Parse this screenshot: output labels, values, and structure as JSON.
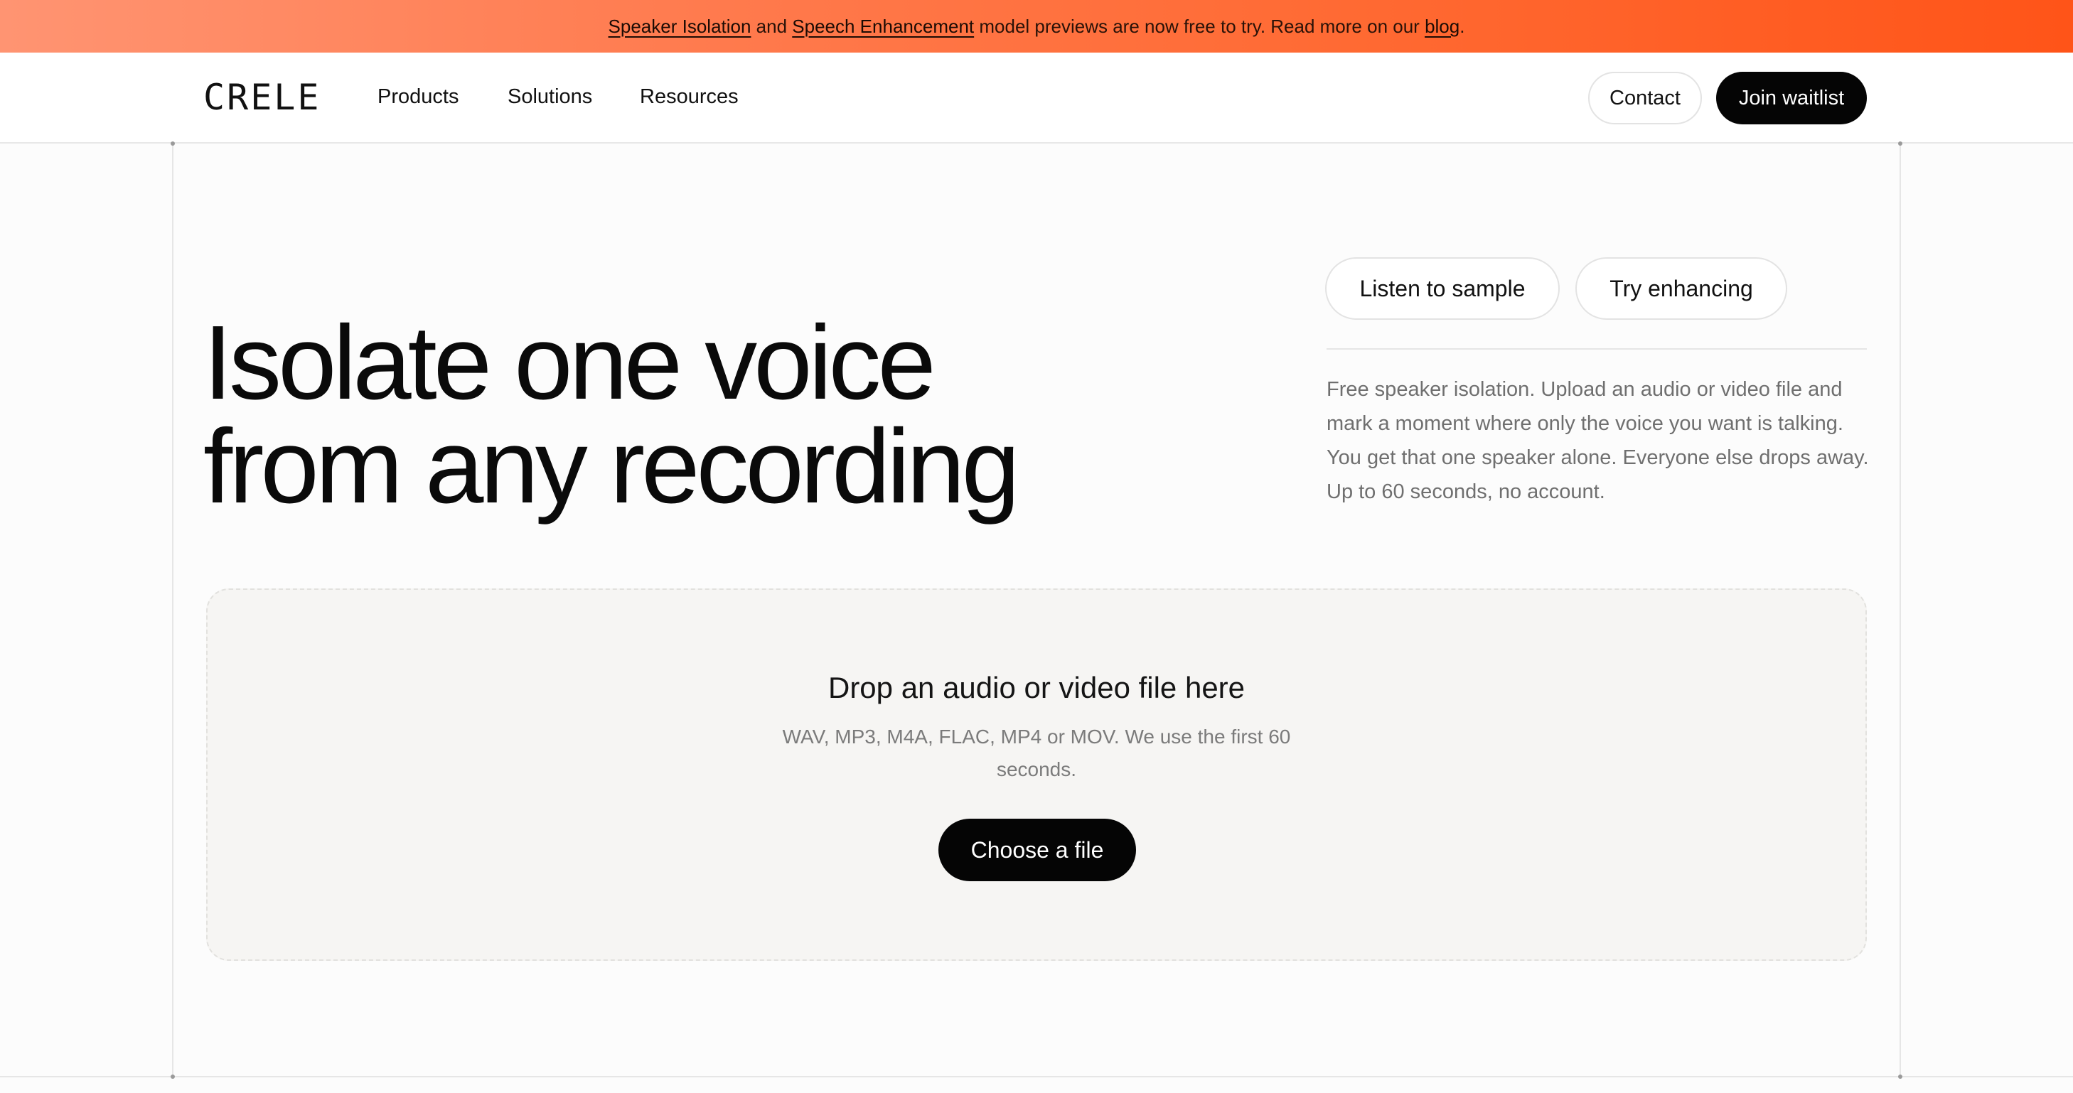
{
  "banner": {
    "link1": "Speaker Isolation",
    "text1": " and ",
    "link2": "Speech Enhancement",
    "text2": " model previews are now free to try. Read more on our ",
    "link3": "blog",
    "text3": "."
  },
  "header": {
    "logo": "CRELE",
    "nav": [
      "Products",
      "Solutions",
      "Resources"
    ],
    "contact_label": "Contact",
    "waitlist_label": "Join waitlist"
  },
  "hero": {
    "headline_line1": "Isolate one voice",
    "headline_line2": "from any recording",
    "listen_label": "Listen to sample",
    "enhance_label": "Try enhancing",
    "description": "Free speaker isolation. Upload an audio or video file and mark a moment where only the voice you want is talking. You get that one speaker alone. Everyone else drops away. Up to 60 seconds, no account."
  },
  "dropzone": {
    "title": "Drop an audio or video file here",
    "subtitle": "WAV, MP3, M4A, FLAC, MP4 or MOV. We use the first 60 seconds.",
    "choose_label": "Choose a file"
  },
  "colors": {
    "banner_start": "#ff9472",
    "banner_end": "#ff5418",
    "primary_button": "#050505",
    "dropzone_bg": "#f6f5f3"
  }
}
